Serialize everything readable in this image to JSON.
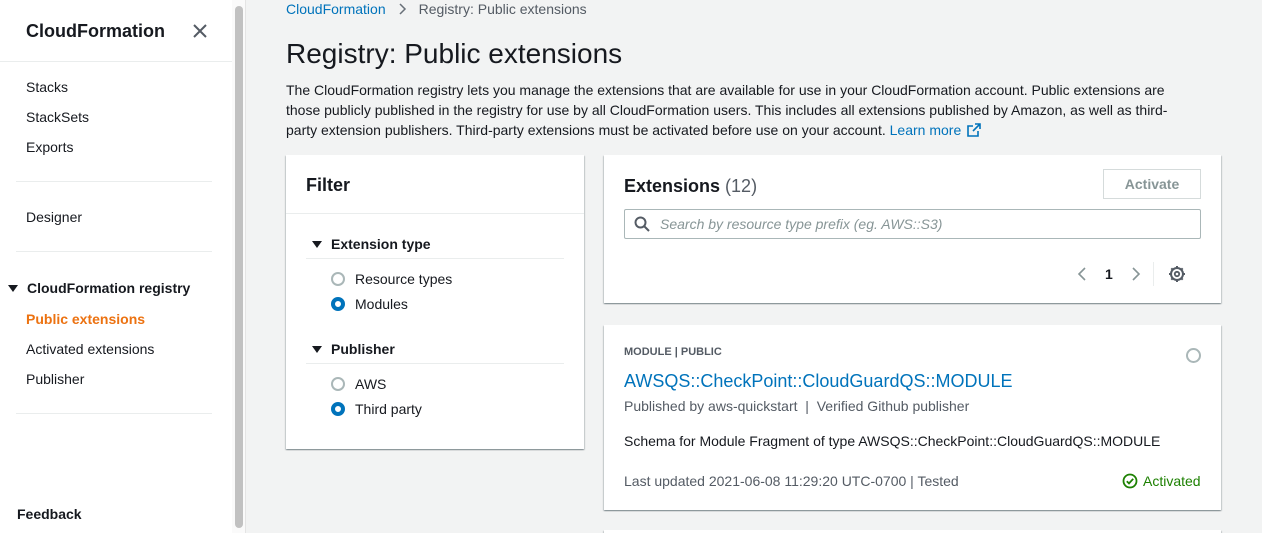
{
  "sidebar": {
    "title": "CloudFormation",
    "items_top": [
      "Stacks",
      "StackSets",
      "Exports"
    ],
    "designer": "Designer",
    "registry_section": "CloudFormation registry",
    "registry_items": [
      "Public extensions",
      "Activated extensions",
      "Publisher"
    ],
    "feedback": "Feedback"
  },
  "breadcrumb": {
    "root": "CloudFormation",
    "current": "Registry: Public extensions"
  },
  "page": {
    "title": "Registry: Public extensions",
    "description": "The CloudFormation registry lets you manage the extensions that are available for use in your CloudFormation account. Public extensions are those publicly published in the registry for use by all CloudFormation users. This includes all extensions published by Amazon, as well as third-party extension publishers. Third-party extensions must be activated before use on your account.",
    "learn_more": "Learn more"
  },
  "filter": {
    "title": "Filter",
    "extension_type": {
      "label": "Extension type",
      "options": [
        "Resource types",
        "Modules"
      ],
      "selected": "Modules"
    },
    "publisher": {
      "label": "Publisher",
      "options": [
        "AWS",
        "Third party"
      ],
      "selected": "Third party"
    }
  },
  "extensions": {
    "title": "Extensions",
    "count": "(12)",
    "activate_label": "Activate",
    "search_placeholder": "Search by resource type prefix (eg. AWS::S3)",
    "page": "1"
  },
  "module": {
    "kind": "MODULE | PUBLIC",
    "name": "AWSQS::CheckPoint::CloudGuardQS::MODULE",
    "published": "Published by aws-quickstart  |  Verified Github publisher",
    "schema": "Schema for Module Fragment of type AWSQS::CheckPoint::CloudGuardQS::MODULE",
    "updated": "Last updated 2021-06-08 11:29:20 UTC-0700 | Tested",
    "status": "Activated"
  },
  "colors": {
    "link": "#0073bb",
    "active_nav": "#ec7211",
    "success": "#1d8102"
  }
}
